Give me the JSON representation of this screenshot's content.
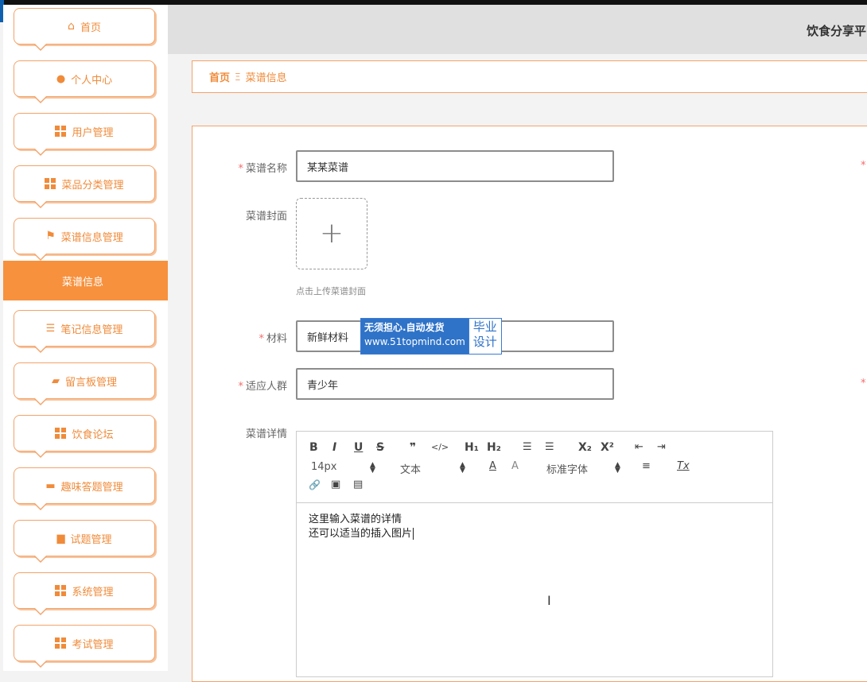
{
  "app": {
    "title": "饮食分享平"
  },
  "sidebar": {
    "items": [
      {
        "label": "首页",
        "icon": "home-icon"
      },
      {
        "label": "个人中心",
        "icon": "user-icon"
      },
      {
        "label": "用户管理",
        "icon": "grid-icon"
      },
      {
        "label": "菜品分类管理",
        "icon": "grid-icon"
      },
      {
        "label": "菜谱信息管理",
        "icon": "flag-icon"
      },
      {
        "label": "笔记信息管理",
        "icon": "sliders-icon"
      },
      {
        "label": "留言板管理",
        "icon": "wallet-icon"
      },
      {
        "label": "饮食论坛",
        "icon": "grid-icon"
      },
      {
        "label": "趣味答题管理",
        "icon": "monitor-icon"
      },
      {
        "label": "试题管理",
        "icon": "basket-icon"
      },
      {
        "label": "系统管理",
        "icon": "grid-icon"
      },
      {
        "label": "考试管理",
        "icon": "grid-icon"
      }
    ],
    "active_submenu": "菜谱信息"
  },
  "breadcrumb": {
    "home": "首页",
    "separator": "Ξ",
    "current": "菜谱信息"
  },
  "form": {
    "name": {
      "label": "菜谱名称",
      "value": "某某菜谱",
      "required": true
    },
    "cover": {
      "label": "菜谱封面",
      "tip": "点击上传菜谱封面"
    },
    "material": {
      "label": "材料",
      "value": "新鲜材料",
      "required": true
    },
    "audience": {
      "label": "适应人群",
      "value": "青少年",
      "required": true
    },
    "detail": {
      "label": "菜谱详情",
      "line1": "这里输入菜谱的详情",
      "line2": "还可以适当的插入图片"
    },
    "required_mark": "*"
  },
  "editor_toolbar": {
    "bold": "B",
    "italic": "I",
    "underline": "U",
    "strike": "S",
    "quote": "❞",
    "code": "</>",
    "h1": "H₁",
    "h2": "H₂",
    "ol": "☰",
    "ul": "☰",
    "sub": "X₂",
    "sup": "X²",
    "outdent": "⇤",
    "indent": "⇥",
    "size": "14px",
    "header": "文本",
    "color": "A",
    "background": "A",
    "font": "标准字体",
    "align": "≡",
    "clean": "Tx",
    "link": "🔗",
    "image": "▣",
    "video": "▤"
  },
  "watermark": {
    "line1": "无须担心.自动发货",
    "line2": "www.51topmind.com",
    "right1": "毕业",
    "right2": "设计"
  },
  "colors": {
    "accent": "#f7913d",
    "border": "#f3a36a",
    "required": "#f56c6c"
  }
}
